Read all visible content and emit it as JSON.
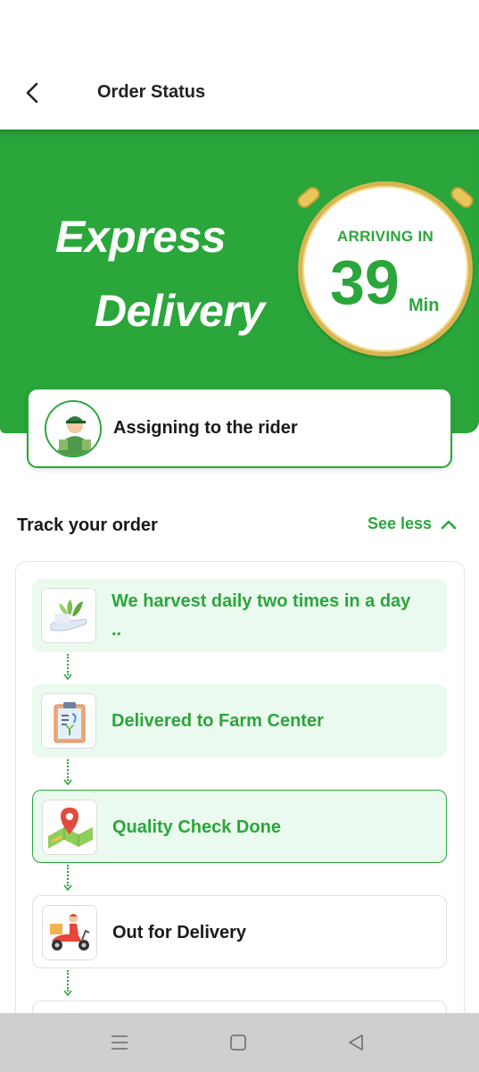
{
  "header": {
    "title": "Order Status",
    "back_icon": "chevron-left-icon"
  },
  "hero": {
    "line1": "Express",
    "line2": "Delivery",
    "arriving_label": "ARRIVING IN",
    "eta_value": "39",
    "eta_unit": "Min",
    "brand_color": "#2aa63b",
    "timer_rim_color": "#d9b552"
  },
  "rider": {
    "status": "Assigning to the rider",
    "avatar_icon": "delivery-rider-avatar-icon"
  },
  "tracking": {
    "title": "Track your order",
    "toggle_label": "See less",
    "toggle_icon": "chevron-up-icon",
    "steps": [
      {
        "label": "We harvest daily two times in a day ..",
        "state": "done",
        "icon": "harvest-hand-icon"
      },
      {
        "label": "Delivered to Farm Center",
        "state": "done",
        "icon": "clipboard-plant-icon"
      },
      {
        "label": "Quality Check Done",
        "state": "current",
        "icon": "map-pin-icon"
      },
      {
        "label": "Out for Delivery",
        "state": "pending",
        "icon": "delivery-scooter-icon"
      }
    ]
  },
  "system_nav": {
    "menu_icon": "menu-lines-icon",
    "home_icon": "square-home-icon",
    "back_icon": "triangle-back-icon"
  }
}
